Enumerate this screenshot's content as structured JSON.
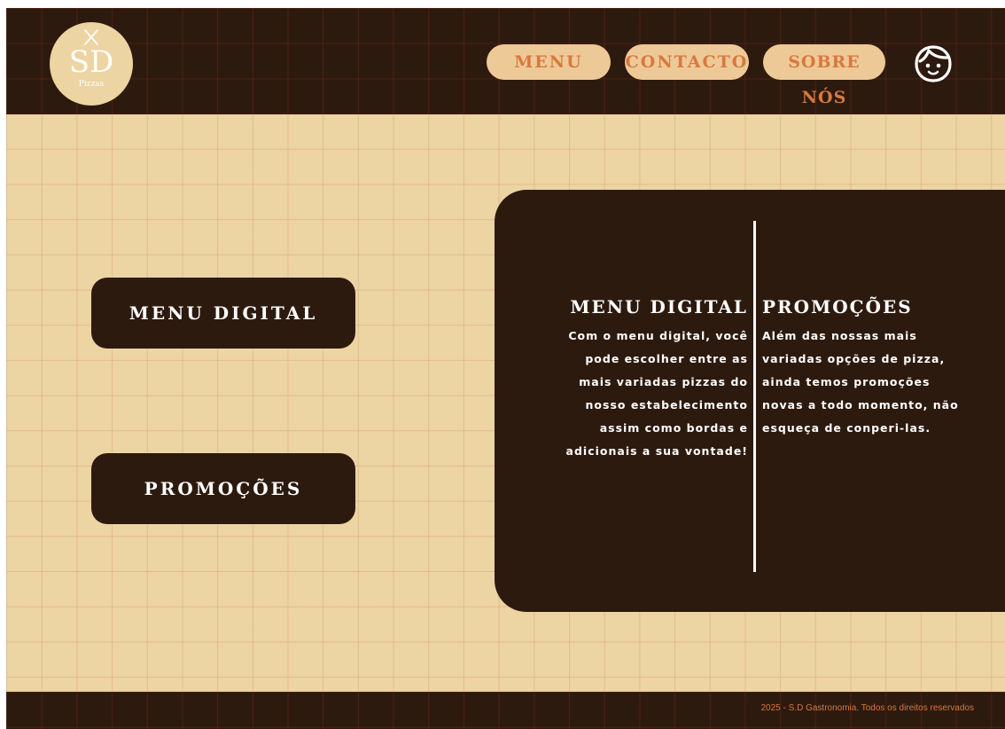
{
  "brand": {
    "logo_initials": "SD",
    "logo_subtitle": "Pizzas",
    "logo_icon": "crossed-utensils-icon"
  },
  "nav": {
    "items": [
      {
        "label": "MENU"
      },
      {
        "label": "CONTACTO"
      },
      {
        "label": "SOBRE NÓS"
      }
    ],
    "profile_icon": "smiley-face-icon"
  },
  "sidebar": {
    "buttons": [
      {
        "label": "MENU DIGITAL"
      },
      {
        "label": "PROMOÇÕES"
      }
    ]
  },
  "info_panel": {
    "left": {
      "title": "MENU DIGITAL",
      "lines": [
        "Com o menu digital, você",
        "pode escolher entre as",
        "mais variadas pizzas do",
        "nosso estabelecimento",
        "assim como bordas e",
        "adicionais a sua vontade!"
      ]
    },
    "right": {
      "title": "PROMOÇÕES",
      "lines": [
        "Além das nossas mais",
        "variadas opções de pizza,",
        "ainda temos promoções",
        "novas a todo momento, não",
        "esqueça de conperi-las."
      ]
    }
  },
  "footer": {
    "text": "2025 - S.D Gastronomia. Todos os direitos reservados"
  },
  "colors": {
    "dark_brown": "#2d1a0e",
    "cream": "#ecd4a3",
    "button_cream": "#eec998",
    "accent_orange": "#d9783d",
    "white": "#ffffff"
  }
}
